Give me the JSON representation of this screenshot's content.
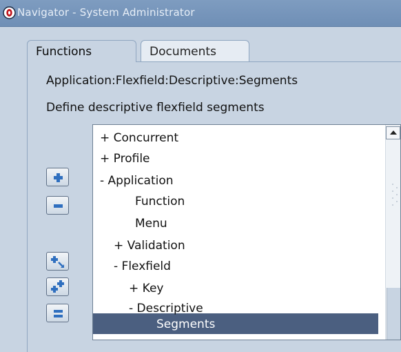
{
  "window": {
    "title": "Navigator - System Administrator"
  },
  "tabs": [
    {
      "label": "Functions",
      "selected": true
    },
    {
      "label": "Documents",
      "selected": false
    }
  ],
  "selected_function": {
    "path": "Application:Flexfield:Descriptive:Segments",
    "description": "Define descriptive flexfield segments"
  },
  "tree": {
    "items": [
      {
        "label": "+ Concurrent"
      },
      {
        "label": "+ Profile"
      },
      {
        "label": "- Application"
      },
      {
        "label": "Function"
      },
      {
        "label": "Menu"
      },
      {
        "label": "+ Validation"
      },
      {
        "label": "- Flexfield"
      },
      {
        "label": "+ Key"
      },
      {
        "label": "- Descriptive"
      },
      {
        "label": "Segments",
        "selected": true
      }
    ]
  },
  "side_buttons": [
    {
      "icon": "expand-plus-icon"
    },
    {
      "icon": "collapse-minus-icon"
    },
    {
      "icon": "expand-branch-icon"
    },
    {
      "icon": "expand-all-icon"
    },
    {
      "icon": "collapse-all-icon"
    }
  ],
  "colors": {
    "titlebar": "#7592b9",
    "background": "#c8d4e2",
    "selection": "#4b5f80",
    "button_icon": "#2f6fbf"
  }
}
